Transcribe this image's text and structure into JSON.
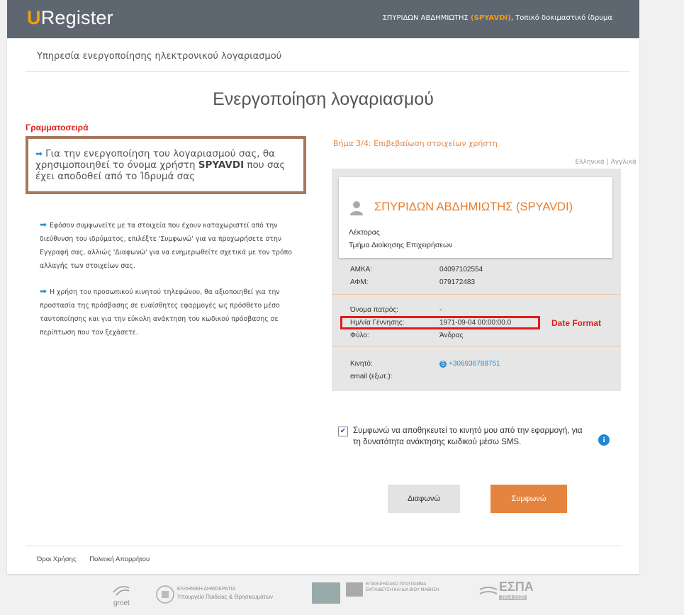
{
  "header": {
    "logo_u": "U",
    "logo_rest": "Register",
    "user_name": "ΣΠΥΡΙΔΩΝ ΑΒΔΗΜΙΩΤΗΣ",
    "user_code": "(SPYAVDI)",
    "institution": ", Τοπικό δοκιμαστικό ίδρυμα"
  },
  "page": {
    "service_title": "Υπηρεσία ενεργοποίησης ηλεκτρονικού λογαριασμού",
    "title": "Ενεργοποίηση λογαριασμού"
  },
  "annotations": {
    "font_label": "Γραμματοσειρά",
    "date_label": "Date Format"
  },
  "info": {
    "p1_before": "Για την ενεργοποίηση του λογαριασμού σας, θα χρησιμοποιηθεί το όνομα χρήστη ",
    "p1_username": "SPYAVDI",
    "p1_after": " που σας έχει αποδοθεί από το Ίδρυμά σας",
    "p2": "Εφόσον συμφωνείτε με τα στοιχεία που έχουν καταχωριστεί από την διεύθυνση του ιδρύματος, επιλέξτε 'Συμφωνώ' για να προχωρήσετε στην Εγγραφή σας, αλλιώς 'Διαφωνώ' για να ενημερωθείτε σχετικά με τον τρόπο αλλαγής των στοιχείων σας.",
    "p3": "Η χρήση του προσωπικού κινητού τηλεφώνου, θα αξιοποιηθεί για την προστασία της πρόσβασης σε ευαίσθητες εφαρμογές ως πρόσθετο μέσο ταυτοποίησης και για την εύκολη ανάκτηση του κωδικού πρόσβασης σε περίπτωση που τον ξεχάσετε."
  },
  "step": "Βήμα 3/4: Επιβεβαίωση στοιχείων χρήστη",
  "language": "Ελληνικά | Αγγλικά",
  "profile": {
    "name": "ΣΠΥΡΙΔΩΝ ΑΒΔΗΜΙΩΤΗΣ (SPYAVDI)",
    "role": "Λέκτορας",
    "department": "Τμήμα Διοίκησης Επιχειρήσεων",
    "amka_label": "ΑΜΚΑ:",
    "amka": "04097102554",
    "afm_label": "ΑΦΜ:",
    "afm": "079172483",
    "father_label": "Όνομα πατρός:",
    "father": "-",
    "dob_label": "Ημ/νία Γέννησης:",
    "dob": "1971-09-04 00:00:00.0",
    "gender_label": "Φύλο:",
    "gender": "Άνδρας",
    "mobile_label": "Κινητό:",
    "mobile": "+306936788751",
    "email_label": "email (εξωτ.):"
  },
  "consent": {
    "checked": true,
    "text": "Συμφωνώ να αποθηκευτεί το κινητό μου από την εφαρμογή, για τη δυνατότητα ανάκτησης κωδικού μέσω SMS."
  },
  "buttons": {
    "disagree": "Διαφωνώ",
    "agree": "Συμφωνώ"
  },
  "footer": {
    "terms": "Όροι Χρήσης",
    "privacy": "Πολιτική Απορρήτου"
  },
  "logos": {
    "grnet": "grnet",
    "ministry_1": "ΕΛΛΗΝΙΚΗ ΔΗΜΟΚΡΑΤΙΑ",
    "ministry_2": "Υπουργείο Παιδείας & Θρησκευμάτων",
    "program_1": "ΕΠΙΧΕΙΡΗΣΙΑΚΟ ΠΡΟΓΡΑΜΜΑ",
    "program_2": "ΕΚΠΑΙΔΕΥΣΗ ΚΑΙ ΔΙΑ ΒΙΟΥ ΜΑΘΗΣΗ",
    "espa": "ΕΣΠΑ",
    "espa_years": "2014-2020"
  }
}
